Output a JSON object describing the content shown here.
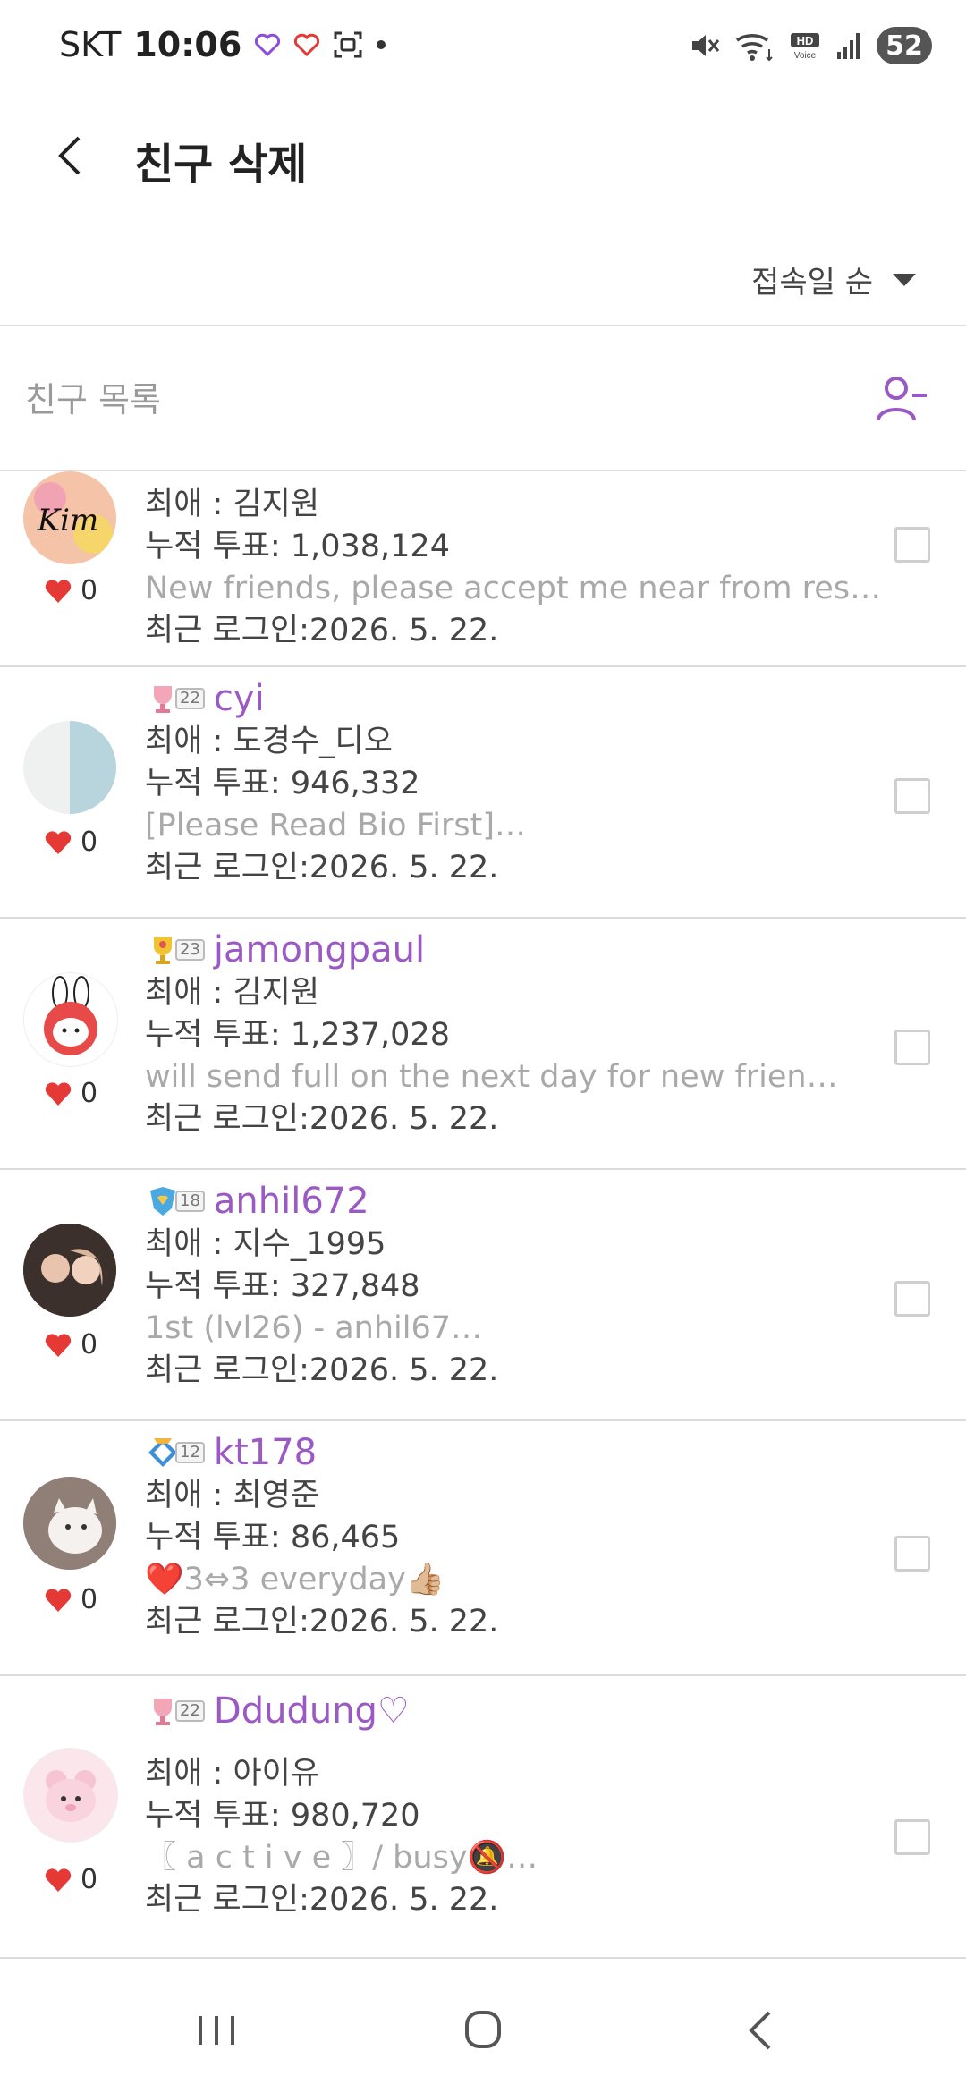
{
  "status_bar": {
    "carrier": "SKT",
    "time": "10:06",
    "battery": "52"
  },
  "header": {
    "title": "친구 삭제"
  },
  "sort": {
    "label": "접속일 순"
  },
  "list": {
    "header_label": "친구 목록"
  },
  "friends": [
    {
      "username": "",
      "level": "",
      "favorite": "최애 : 김지원",
      "votes": "누적 투표: 1,038,124",
      "message": "New friends, please accept me near from res…",
      "last_login": "최근 로그인:2026. 5. 22.",
      "likes": "0",
      "avatar_color": "#f4c3a8"
    },
    {
      "username": "cyi",
      "level": "22",
      "favorite": "최애 : 도경수_디오",
      "votes": "누적 투표: 946,332",
      "message": "[Please Read Bio First]…",
      "last_login": "최근 로그인:2026. 5. 22.",
      "likes": "0",
      "avatar_color": "#d9e7ea"
    },
    {
      "username": "jamongpaul",
      "level": "23",
      "favorite": "최애 : 김지원",
      "votes": "누적 투표: 1,237,028",
      "message": "will send full on the next day for new frien…",
      "last_login": "최근 로그인:2026. 5. 22.",
      "likes": "0",
      "avatar_color": "#e84a4a"
    },
    {
      "username": "anhil672",
      "level": "18",
      "favorite": "최애 : 지수_1995",
      "votes": "누적 투표: 327,848",
      "message": "1st (lvl26) - anhil67…",
      "last_login": "최근 로그인:2026. 5. 22.",
      "likes": "0",
      "avatar_color": "#5a4a44"
    },
    {
      "username": "kt178",
      "level": "12",
      "favorite": "최애 : 최영준",
      "votes": "누적 투표: 86,465",
      "message": "❤️3⇔3  everyday👍🏼",
      "last_login": "최근 로그인:2026. 5. 22.",
      "likes": "0",
      "avatar_color": "#b9a89a"
    },
    {
      "username": "Ddudung♡",
      "level": "22",
      "favorite": "최애 : 아이유",
      "votes": "누적 투표: 980,720",
      "message": "〖 a c t i v e 〗/ busy🔕…",
      "last_login": "최근 로그인:2026. 5. 22.",
      "likes": "0",
      "avatar_color": "#f7d6e0"
    }
  ],
  "colors": {
    "accent": "#9b59c4",
    "heart": "#e53935",
    "divider": "#dddddd"
  }
}
